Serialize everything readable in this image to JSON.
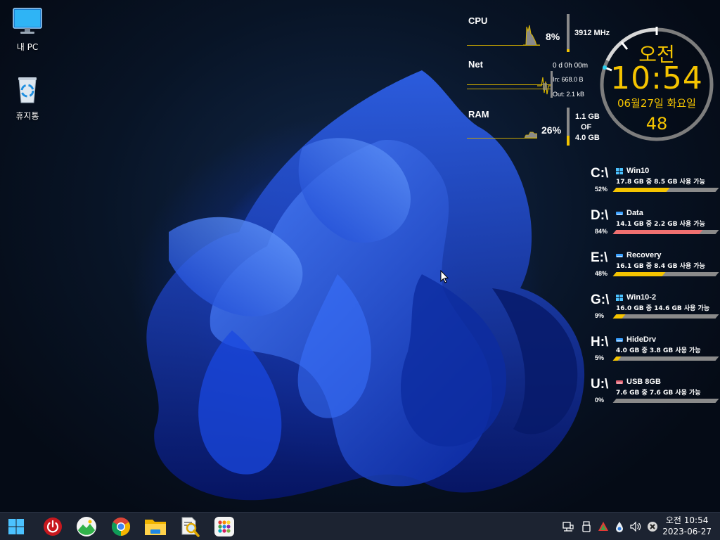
{
  "desktop_icons": [
    {
      "label": "내 PC",
      "icon": "monitor-icon"
    },
    {
      "label": "휴지통",
      "icon": "recycle-bin-icon"
    }
  ],
  "monitor": {
    "cpu": {
      "label": "CPU",
      "percent": "8%",
      "freq": "3912 MHz",
      "level": 0.08
    },
    "net": {
      "label": "Net",
      "uptime": "0 d 0h 00m",
      "in": "In: 668.0 B",
      "out": "Out: 2.1 kB"
    },
    "ram": {
      "label": "RAM",
      "percent": "26%",
      "used": "1.1 GB",
      "of": "OF",
      "total": "4.0 GB",
      "level": 0.26
    }
  },
  "clock": {
    "ampm": "오전",
    "time": "10:54",
    "date": "06월27일 화요일",
    "seconds": "48",
    "accent": "#f5c400"
  },
  "drives": [
    {
      "letter": "C:\\",
      "percent": "52%",
      "name": "Win10",
      "info": "17.8 GB 중  8.5 GB 사용 가능",
      "level": 0.52,
      "bar_color": "#f5c400",
      "icon": "windows-drive-icon"
    },
    {
      "letter": "D:\\",
      "percent": "84%",
      "name": "Data",
      "info": "14.1 GB 중  2.2 GB 사용 가능",
      "level": 0.84,
      "bar_color": "#f07070",
      "icon": "drive-icon"
    },
    {
      "letter": "E:\\",
      "percent": "48%",
      "name": "Recovery",
      "info": "16.1 GB 중  8.4 GB 사용 가능",
      "level": 0.48,
      "bar_color": "#f5c400",
      "icon": "drive-icon"
    },
    {
      "letter": "G:\\",
      "percent": "9%",
      "name": "Win10-2",
      "info": "16.0 GB 중  14.6 GB 사용 가능",
      "level": 0.09,
      "bar_color": "#f5c400",
      "icon": "windows-drive-icon"
    },
    {
      "letter": "H:\\",
      "percent": "5%",
      "name": "HideDrv",
      "info": "4.0 GB 중  3.8 GB 사용 가능",
      "level": 0.05,
      "bar_color": "#f5c400",
      "icon": "drive-icon"
    },
    {
      "letter": "U:\\",
      "percent": "0%",
      "name": "USB 8GB",
      "info": "7.6 GB 중  7.6 GB 사용 가능",
      "level": 0.0,
      "bar_color": "#f5c400",
      "icon": "usb-drive-icon"
    }
  ],
  "taskbar": {
    "apps": [
      {
        "name": "start-button",
        "icon": "windows-logo-icon"
      },
      {
        "name": "power-button",
        "icon": "power-icon"
      },
      {
        "name": "photos-app-button",
        "icon": "photos-icon"
      },
      {
        "name": "chrome-app-button",
        "icon": "chrome-icon"
      },
      {
        "name": "file-explorer-button",
        "icon": "folder-icon"
      },
      {
        "name": "search-tool-button",
        "icon": "document-search-icon"
      },
      {
        "name": "app-launcher-button",
        "icon": "apps-grid-icon"
      }
    ],
    "tray": [
      "network-icon",
      "usb-icon",
      "warning-triangle-icon",
      "water-drop-icon",
      "volume-icon",
      "close-circle-icon"
    ],
    "time": "오전 10:54",
    "date": "2023-06-27"
  }
}
